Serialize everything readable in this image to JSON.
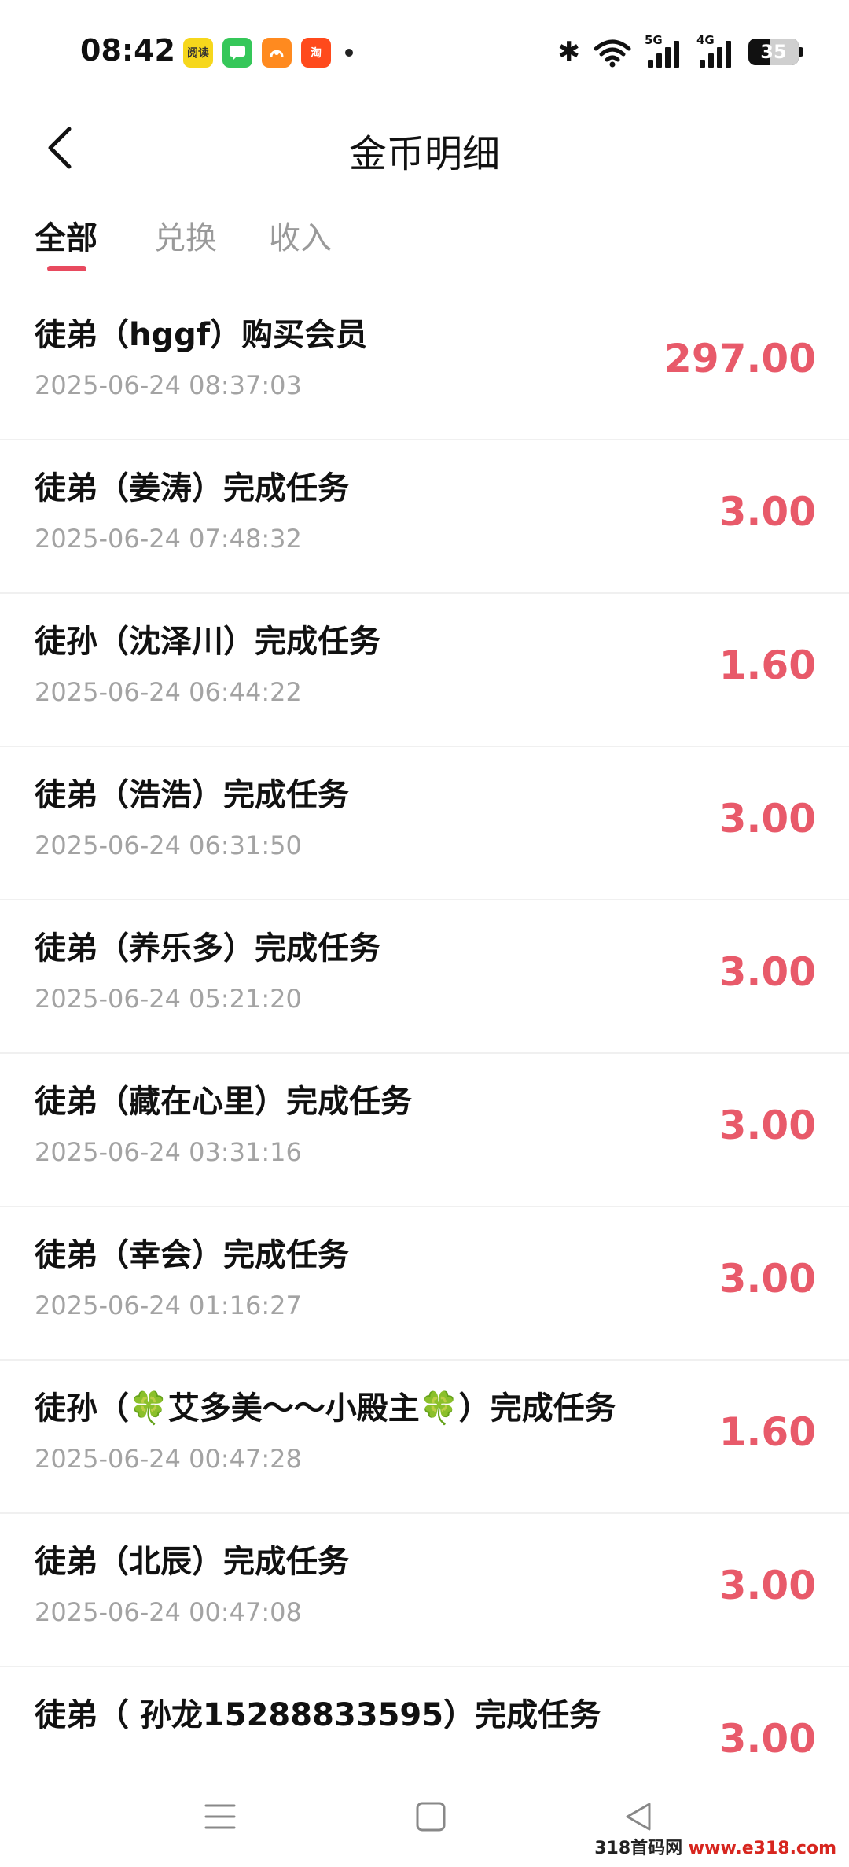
{
  "status_bar": {
    "time": "08:42",
    "notifications": [
      {
        "icon": "reader-app-icon",
        "label": "阅读"
      },
      {
        "icon": "messages-app-icon",
        "label": ""
      },
      {
        "icon": "orange-app-icon",
        "label": ""
      },
      {
        "icon": "taobao-app-icon",
        "label": "淘"
      }
    ],
    "signal1_tag": "5G",
    "signal2_tag": "4G",
    "battery": "35"
  },
  "header": {
    "title": "金币明细"
  },
  "tabs": [
    {
      "label": "全部",
      "active": true
    },
    {
      "label": "兑换",
      "active": false
    },
    {
      "label": "收入",
      "active": false
    }
  ],
  "records": [
    {
      "title": "徒弟（hggf）购买会员",
      "time": "2025-06-24 08:37:03",
      "amount": "297.00"
    },
    {
      "title": "徒弟（姜涛）完成任务",
      "time": "2025-06-24 07:48:32",
      "amount": "3.00"
    },
    {
      "title": "徒孙（沈泽川）完成任务",
      "time": "2025-06-24 06:44:22",
      "amount": "1.60"
    },
    {
      "title": "徒弟（浩浩）完成任务",
      "time": "2025-06-24 06:31:50",
      "amount": "3.00"
    },
    {
      "title": "徒弟（养乐多）完成任务",
      "time": "2025-06-24 05:21:20",
      "amount": "3.00"
    },
    {
      "title": "徒弟（藏在心里）完成任务",
      "time": "2025-06-24 03:31:16",
      "amount": "3.00"
    },
    {
      "title": "徒弟（幸会）完成任务",
      "time": "2025-06-24 01:16:27",
      "amount": "3.00"
    },
    {
      "title": "徒孙（🍀艾多美～～小殿主🍀）完成任务",
      "time": "2025-06-24 00:47:28",
      "amount": "1.60"
    },
    {
      "title": "徒弟（北辰）完成任务",
      "time": "2025-06-24 00:47:08",
      "amount": "3.00"
    },
    {
      "title": "徒弟（          孙龙15288833595）完成任务",
      "time": "",
      "amount": "3.00"
    }
  ],
  "watermark": {
    "prefix": "318首码网 ",
    "url": "www.e318.com"
  }
}
